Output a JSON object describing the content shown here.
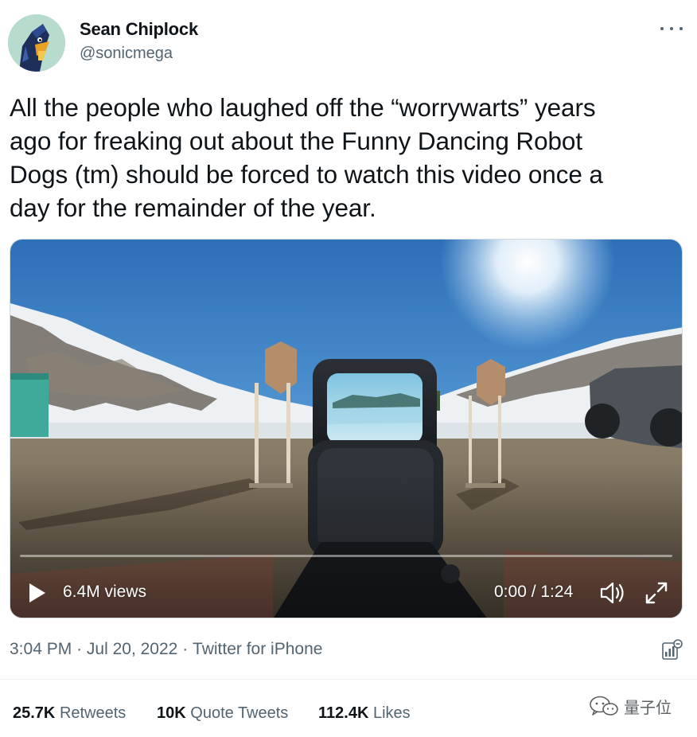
{
  "author": {
    "name": "Sean Chiplock",
    "handle": "@sonicmega",
    "avatar_icon": "avatar-character-icon"
  },
  "more_icon": "more-horizontal-icon",
  "tweet": {
    "text_lines": [
      "All the people who laughed off the “worrywarts” years",
      "ago for freaking out about the Funny Dancing Robot",
      "Dogs (tm) should be forced to watch this video once a",
      "day for the remainder of the year."
    ]
  },
  "video": {
    "views": "6.4M views",
    "time": "0:00 / 1:24",
    "progress": 0,
    "play_icon": "play-icon",
    "volume_icon": "volume-icon",
    "fullscreen_icon": "fullscreen-icon"
  },
  "meta": {
    "time": "3:04 PM",
    "separator": "·",
    "date": "Jul 20, 2022",
    "source": "Twitter for iPhone",
    "analytics_icon": "analytics-icon"
  },
  "stats": {
    "retweets_count": "25.7K",
    "retweets_label": "Retweets",
    "quotes_count": "10K",
    "quotes_label": "Quote Tweets",
    "likes_count": "112.4K",
    "likes_label": "Likes"
  },
  "watermark": {
    "text": "量子位",
    "icon": "wechat-icon"
  },
  "colors": {
    "text_primary": "#0f1419",
    "text_secondary": "#536471",
    "divider": "#eff3f4"
  }
}
